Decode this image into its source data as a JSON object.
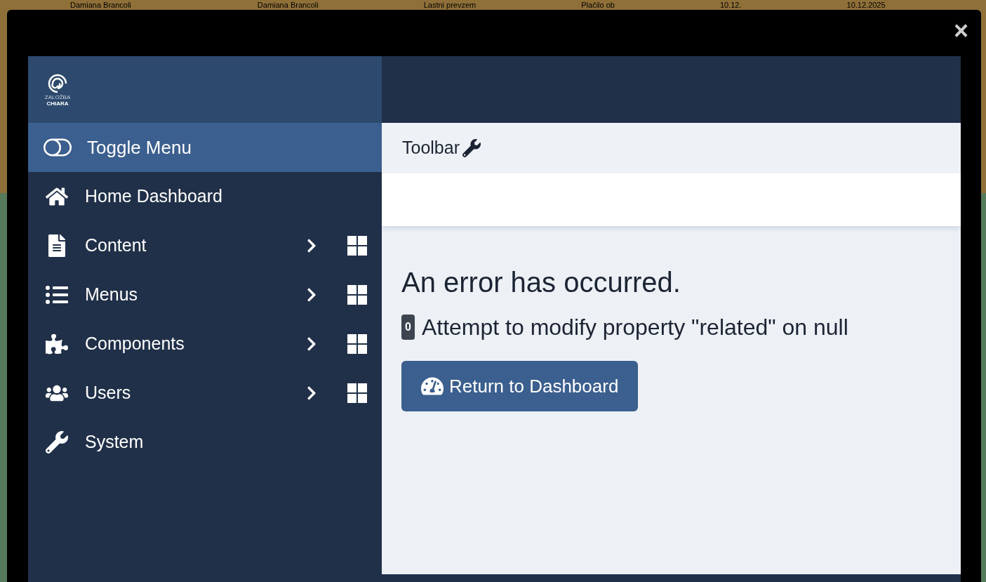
{
  "background_row": {
    "cells": [
      "Damiana Brancoli",
      "Damiana Brancoli",
      "Lastni prevzem",
      "Plačilo ob",
      "10.12.",
      "10.12.2025"
    ]
  },
  "modal": {
    "close": "×"
  },
  "logo": {
    "line1": "ZALOŽBA",
    "line2": "CHIARA"
  },
  "sidebar": {
    "toggle": "Toggle Menu",
    "items": [
      {
        "label": "Home Dashboard",
        "expandable": false
      },
      {
        "label": "Content",
        "expandable": true
      },
      {
        "label": "Menus",
        "expandable": true
      },
      {
        "label": "Components",
        "expandable": true
      },
      {
        "label": "Users",
        "expandable": true
      },
      {
        "label": "System",
        "expandable": false
      }
    ]
  },
  "toolbar": {
    "label": "Toolbar"
  },
  "error": {
    "title": "An error has occurred.",
    "code": "0",
    "message": "Attempt to modify property \"related\" on null",
    "button": "Return to Dashboard"
  }
}
